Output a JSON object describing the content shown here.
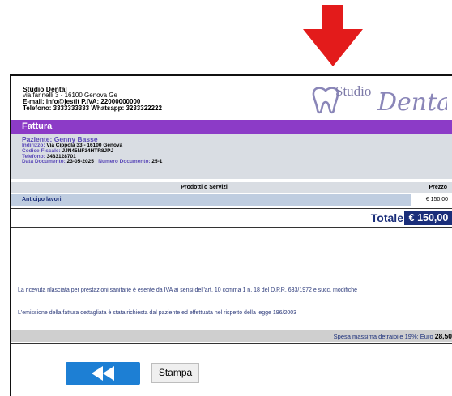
{
  "company": {
    "name": "Studio Dental",
    "address": "via farinelli 3 - 16100 Genova Ge",
    "email_line": "E-mail: info@jestit  P.IVA: 22000000000",
    "phone_line": "Telefono: 3333333333  Whatsapp: 3233322222"
  },
  "logo": {
    "text_top": "Studio",
    "text_script": "Dental",
    "icon": "tooth-icon"
  },
  "invoice": {
    "section_title": "Fattura",
    "patient": {
      "name_label": "Paziente:",
      "name": "Genny Basse",
      "address_label": "Indirizzo:",
      "address": "Via Cippola 33 - 16100 Genova",
      "tax_code_label": "Codice Fiscale:",
      "tax_code": "JJN45NF34HTR8JPJ",
      "phone_label": "Telefono:",
      "phone": "3483128701",
      "date_label": "Data Documento:",
      "date": "23-05-2025",
      "number_label": "Numero Documento:",
      "number": "25-1"
    },
    "products_header": "Prodotti o Servizi",
    "price_header": "Prezzo",
    "items": [
      {
        "description": "Anticipo lavori",
        "price": "€ 150,00"
      }
    ],
    "total_label": "Totale",
    "total_value": "€ 150,00",
    "note_vat": "La ricevuta rilasciata per prestazioni sanitarie è esente da IVA ai sensi dell'art. 10 comma 1 n. 18 del D.P.R. 633/1972 e succ. modifiche",
    "note_detail": "L'emissione della fattura dettagliata è stata richiesta dal paziente ed effettuata nel rispetto della legge 196/2003",
    "deductible_label": "Spesa massima detraibile 19%: Euro",
    "deductible_value": "28,50"
  },
  "buttons": {
    "back_icon": "rewind-icon",
    "print_label": "Stampa"
  },
  "colors": {
    "annotation_arrow": "#e31b1b",
    "header_bar": "#8c3bc7",
    "total_box": "#1a2e7a",
    "back_button": "#1d7fd4"
  }
}
